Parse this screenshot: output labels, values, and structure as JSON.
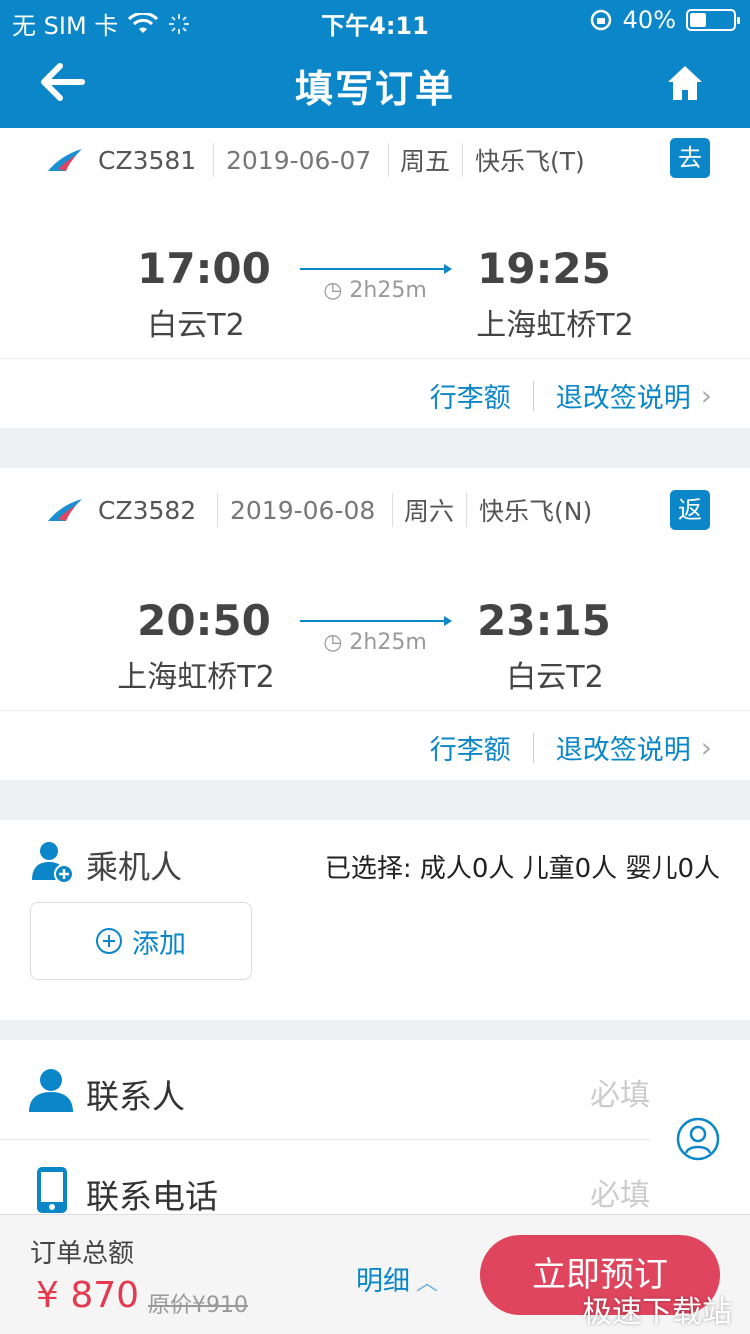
{
  "status_bar": {
    "carrier": "无 SIM 卡",
    "time": "下午4:11",
    "battery": "40%",
    "battery_level": 0.4
  },
  "nav": {
    "title": "填写订单",
    "back_icon": "arrow-left-icon",
    "home_icon": "home-icon"
  },
  "flights": [
    {
      "flight_no": "CZ3581",
      "date": "2019-06-07",
      "weekday": "周五",
      "cabin": "快乐飞(T)",
      "direction": "去",
      "dep_time": "17:00",
      "dep_airport": "白云T2",
      "duration": "2h25m",
      "arr_time": "19:25",
      "arr_airport": "上海虹桥T2",
      "baggage": "行李额",
      "rules": "退改签说明"
    },
    {
      "flight_no": "CZ3582",
      "date": "2019-06-08",
      "weekday": "周六",
      "cabin": "快乐飞(N)",
      "direction": "返",
      "dep_time": "20:50",
      "dep_airport": "上海虹桥T2",
      "duration": "2h25m",
      "arr_time": "23:15",
      "arr_airport": "白云T2",
      "baggage": "行李额",
      "rules": "退改签说明"
    }
  ],
  "passenger": {
    "title": "乘机人",
    "summary": "已选择:  成人0人   儿童0人   婴儿0人",
    "add_label": "添加"
  },
  "contact": {
    "name_label": "联系人",
    "name_placeholder": "必填",
    "phone_label": "联系电话",
    "phone_placeholder": "必填"
  },
  "footer": {
    "total_label": "订单总额",
    "total_price": "¥ 870",
    "original_price": "原价¥910",
    "detail": "明细",
    "book": "立即预订"
  },
  "watermark": "极速下载站",
  "colors": {
    "primary": "#0a86c9",
    "accent": "#e0455e",
    "price": "#e4394f"
  }
}
